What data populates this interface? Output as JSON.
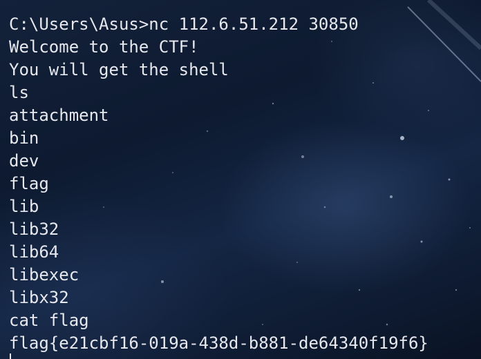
{
  "terminal": {
    "lines": [
      "C:\\Users\\Asus>nc 112.6.51.212 30850",
      "Welcome to the CTF!",
      "You will get the shell",
      "ls",
      "attachment",
      "bin",
      "dev",
      "flag",
      "lib",
      "lib32",
      "lib64",
      "libexec",
      "libx32",
      "cat flag",
      "flag{e21cbf16-019a-438d-b881-de64340f19f6}"
    ],
    "text_color": "#e6e8ee",
    "background_theme": "starry-night-sky"
  }
}
